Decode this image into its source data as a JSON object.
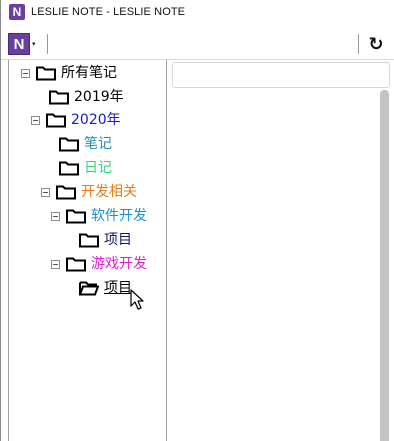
{
  "window": {
    "title": "LESLIE NOTE - LESLIE NOTE",
    "app_icon_letter": "N"
  },
  "toolbar": {
    "logo_letter": "N",
    "logo_caret": "▾",
    "refresh_icon": "↻",
    "search_placeholder": ""
  },
  "tree": {
    "root": {
      "label": "所有笔记",
      "color": "#000000"
    },
    "items": [
      {
        "label": "2019年",
        "color": "#000000"
      },
      {
        "label": "2020年",
        "color": "#1a1ac8"
      },
      {
        "label": "笔记",
        "color": "#1f8fa8"
      },
      {
        "label": "日记",
        "color": "#2fd67a"
      },
      {
        "label": "开发相关",
        "color": "#f07a10"
      },
      {
        "label": "软件开发",
        "color": "#1a90d8"
      },
      {
        "label": "项目",
        "color": "#141470"
      },
      {
        "label": "游戏开发",
        "color": "#e020d8"
      },
      {
        "label": "项目",
        "color": "#000000"
      }
    ]
  },
  "colors": {
    "brand": "#6b3fa0",
    "scrollbar": "#c4c4c4"
  }
}
